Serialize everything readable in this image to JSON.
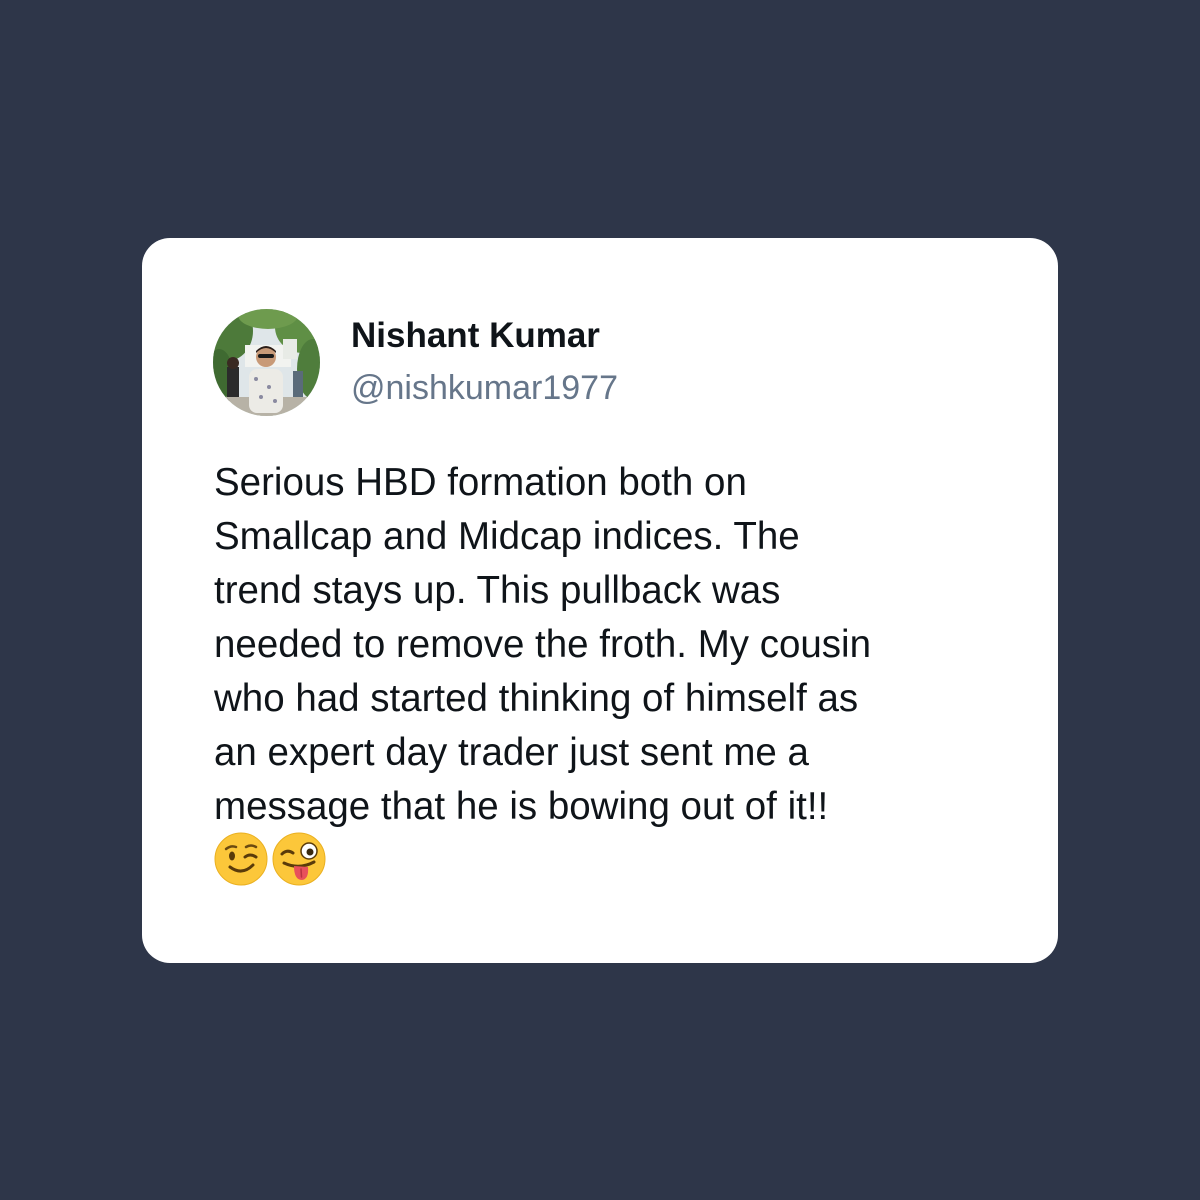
{
  "tweet": {
    "author": {
      "display_name": "Nishant Kumar",
      "handle": "@nishkumar1977",
      "avatar_icon": "profile-photo"
    },
    "text_lines": [
      "Serious HBD formation both on",
      "Smallcap and Midcap indices. The",
      "trend stays up. This pullback was",
      "needed to remove the froth. My cousin",
      "who had started thinking of himself as",
      "an expert day trader just sent me a",
      "message that he is bowing out of it!!"
    ],
    "emojis": [
      "winking-face-icon",
      "zany-face-icon"
    ]
  },
  "colors": {
    "background": "#2e3649",
    "card": "#ffffff",
    "name_text": "#0f1419",
    "handle_text": "#66768a",
    "body_text": "#0f1419"
  }
}
